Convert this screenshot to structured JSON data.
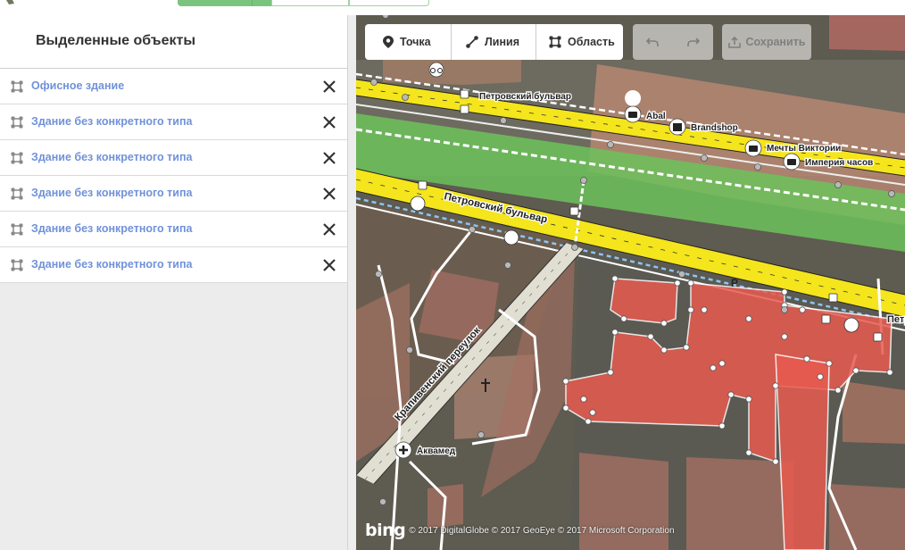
{
  "sidebar": {
    "title": "Выделенные объекты",
    "items": [
      {
        "label": "Офисное здание"
      },
      {
        "label": "Здание без конкретного типа"
      },
      {
        "label": "Здание без конкретного типа"
      },
      {
        "label": "Здание без конкретного типа"
      },
      {
        "label": "Здание без конкретного типа"
      },
      {
        "label": "Здание без конкретного типа"
      }
    ]
  },
  "toolbar": {
    "point_label": "Точка",
    "line_label": "Линия",
    "area_label": "Область",
    "save_label": "Сохранить"
  },
  "map": {
    "labels": {
      "petrovsky_top": "Петровский бульвар",
      "petrovsky_road": "Петровский бульвар",
      "petr_edge": "Петр",
      "krapivensky": "Крапивенский переулок",
      "abal": "Abal",
      "brandshop": "Brandshop",
      "mechty": "Мечты Виктории",
      "imperia": "Империя часов",
      "akvamed": "Аквамед"
    },
    "attribution_logo": "bing",
    "attribution": "© 2017 DigitalGlobe © 2017 GeoEye © 2017 Microsoft Corporation"
  },
  "colors": {
    "accent_green": "#7bc47f",
    "link_blue": "#7092d9",
    "selected_red": "#e85a4f",
    "road_yellow": "#f4e51c",
    "park_green": "#6cc25b"
  }
}
